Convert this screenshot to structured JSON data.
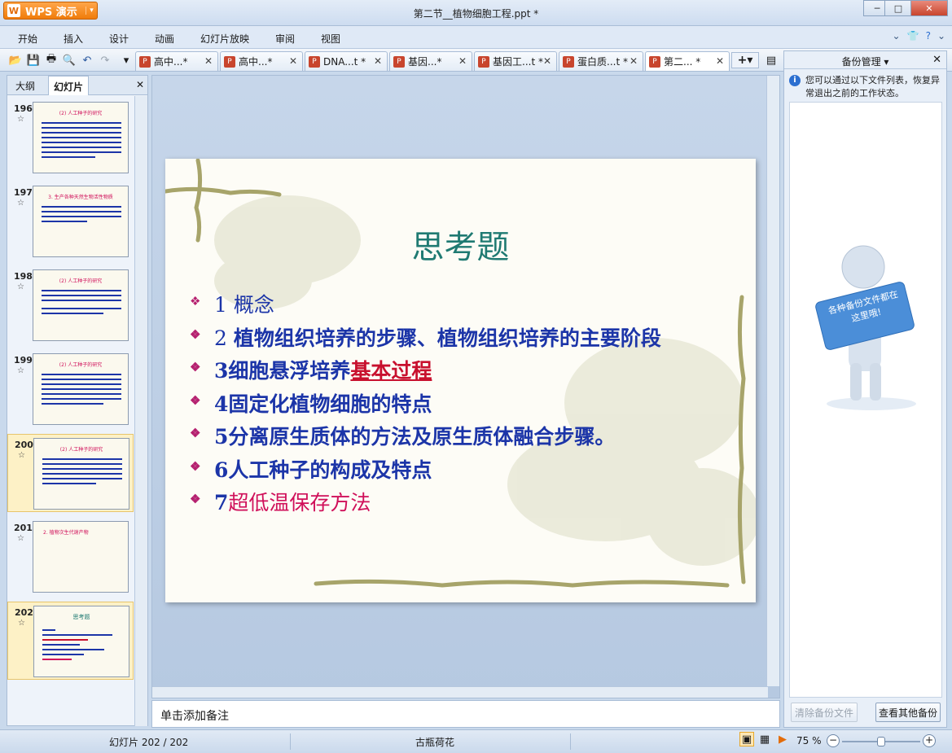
{
  "app": {
    "title": "WPS 演示",
    "logo_letter": "W",
    "document_title": "第二节__植物细胞工程.ppt *"
  },
  "window_controls": [
    "─",
    "□",
    "✕"
  ],
  "menu": [
    "开始",
    "插入",
    "设计",
    "动画",
    "幻灯片放映",
    "审阅",
    "视图"
  ],
  "doc_tabs": [
    {
      "label": "高中...*",
      "active": false
    },
    {
      "label": "高中...*",
      "active": false
    },
    {
      "label": "DNA...t *",
      "active": false
    },
    {
      "label": "基因...*",
      "active": false
    },
    {
      "label": "基因工...t *",
      "active": false
    },
    {
      "label": "蛋白质...t *",
      "active": false
    },
    {
      "label": "第二... *",
      "active": true
    }
  ],
  "left_panel": {
    "tab_outline": "大纲",
    "tab_slides": "幻灯片",
    "thumbnails": [
      {
        "num": "196",
        "title": "(2) 人工种子的研究",
        "selected": false
      },
      {
        "num": "197",
        "title": "3. 生产各种天然生物活性物质",
        "selected": false
      },
      {
        "num": "198",
        "title": "(2) 人工种子的研究",
        "selected": false
      },
      {
        "num": "199",
        "title": "(2) 人工种子的研究",
        "selected": false
      },
      {
        "num": "200",
        "title": "(2) 人工种子的研究",
        "selected": true
      },
      {
        "num": "201",
        "title": "2. 植物次生代谢产物",
        "selected": false
      },
      {
        "num": "202",
        "title": "思考题",
        "selected": true
      }
    ]
  },
  "slide": {
    "title": "思考题",
    "bullets": [
      {
        "prefix": "1 ",
        "text": "概念",
        "style": "plain"
      },
      {
        "prefix": "2 ",
        "text": "植物组织培养的步骤、植物组织培养的主要阶段",
        "style": "bold"
      },
      {
        "prefix": "3细胞悬浮培养",
        "text": "基本过程",
        "style": "red"
      },
      {
        "prefix": "4固定化植物细胞的特点",
        "text": "",
        "style": "bold"
      },
      {
        "prefix": "5分离原生质体的方法及原生质体融合步骤。",
        "text": "",
        "style": "bold"
      },
      {
        "prefix": "6人工种子的构成及特点",
        "text": "",
        "style": "bold"
      },
      {
        "prefix": "7",
        "text": "超低温保存方法",
        "style": "pink"
      }
    ]
  },
  "notes": {
    "placeholder": "单击添加备注"
  },
  "right_panel": {
    "title": "备份管理",
    "info": "您可以通过以下文件列表，恢复异常退出之前的工作状态。",
    "sign_text": "各种备份文件都在这里哦!",
    "clear_button": "清除备份文件",
    "view_button": "查看其他备份"
  },
  "status_bar": {
    "slide_counter": "幻灯片 202 / 202",
    "theme": "古瓶荷花",
    "zoom": "75 %",
    "zoom_level": 0.5
  }
}
